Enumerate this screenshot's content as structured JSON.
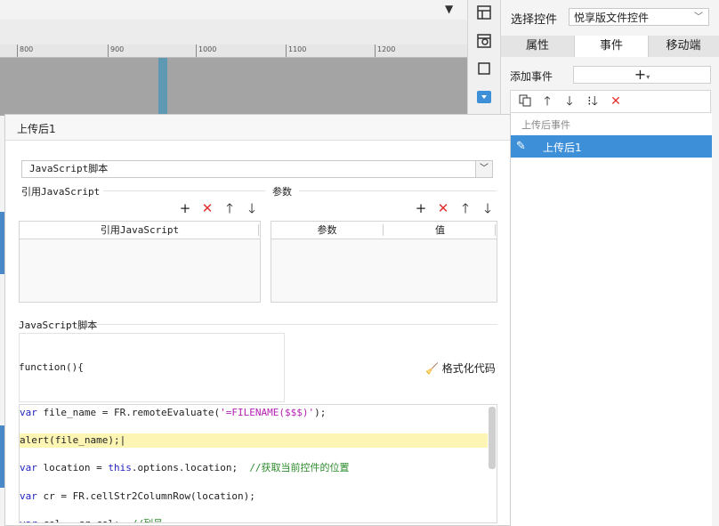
{
  "ruler_ticks": [
    "800",
    "900",
    "1000",
    "1100",
    "1200"
  ],
  "right_panel": {
    "select_label": "选择控件",
    "select_value": "悦享版文件控件",
    "tabs": [
      "属性",
      "事件",
      "移动端"
    ],
    "add_event_label": "添加事件",
    "add_event_button": "+",
    "event_group": "上传后事件",
    "event_item": "上传后1"
  },
  "dialog": {
    "title": "上传后1",
    "type_select": "JavaScript脚本",
    "ref_js_title": "引用JavaScript",
    "params_title": "参数",
    "ref_table_header": "引用JavaScript",
    "params_headers": [
      "参数",
      "值"
    ],
    "script_title": "JavaScript脚本",
    "function_header": "function(){",
    "format_label": "格式化代码"
  },
  "code_lines": [
    {
      "parts": [
        {
          "t": "var",
          "c": "kw"
        },
        {
          "t": " file_name = FR.remoteEvaluate(",
          "c": ""
        },
        {
          "t": "'=FILENAME($$$)'",
          "c": "str"
        },
        {
          "t": ");",
          "c": ""
        }
      ]
    },
    {
      "parts": [
        {
          "t": "alert(file_name);",
          "c": ""
        }
      ],
      "highlight": true
    },
    {
      "parts": [
        {
          "t": "var",
          "c": "kw"
        },
        {
          "t": " location = ",
          "c": ""
        },
        {
          "t": "this",
          "c": "kw"
        },
        {
          "t": ".options.location;  ",
          "c": ""
        },
        {
          "t": "//获取当前控件的位置",
          "c": "cmt"
        }
      ]
    },
    {
      "parts": [
        {
          "t": "var",
          "c": "kw"
        },
        {
          "t": " cr = FR.cellStr2ColumnRow(location);",
          "c": ""
        }
      ]
    },
    {
      "parts": [
        {
          "t": "var",
          "c": "kw"
        },
        {
          "t": " col = cr.col;  ",
          "c": ""
        },
        {
          "t": "//列号",
          "c": "cmt"
        }
      ]
    }
  ],
  "colors": {
    "accent": "#3d8fd8",
    "delete": "#e03030",
    "highlight": "#fdf5b3",
    "keyword": "#1f1fbf",
    "string": "#b21fb2",
    "comment": "#2e8b2e"
  }
}
